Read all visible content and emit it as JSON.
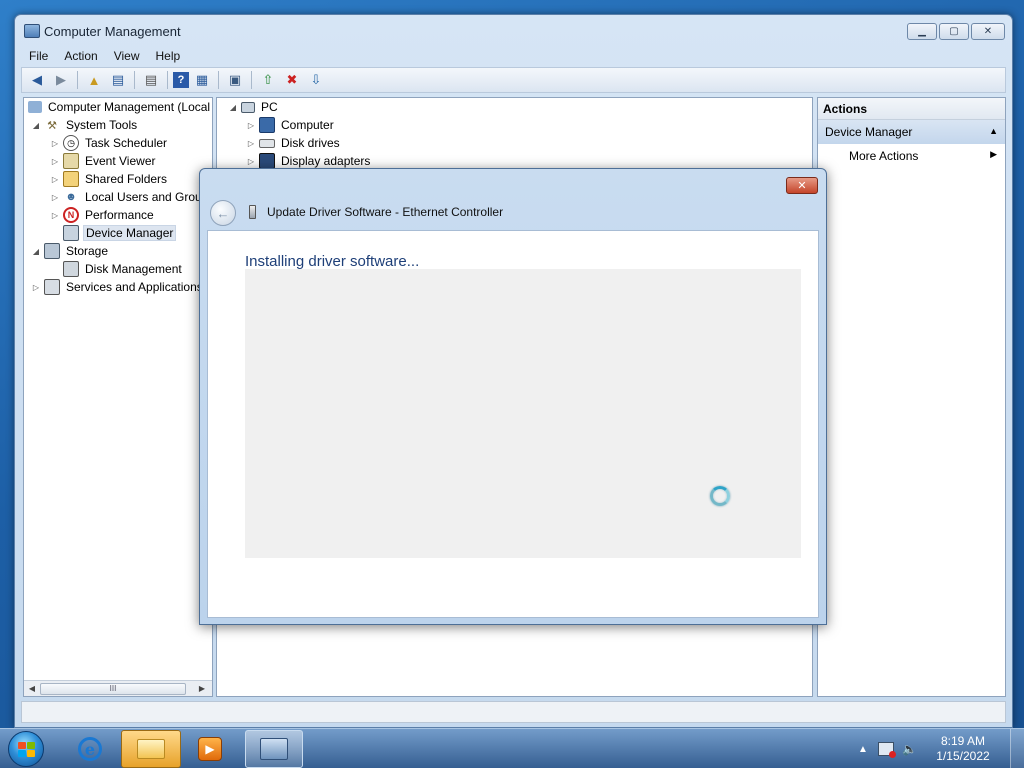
{
  "window": {
    "title": "Computer Management",
    "minimize_glyph": "▁",
    "maximize_glyph": "▢",
    "close_glyph": "✕"
  },
  "menu": [
    "File",
    "Action",
    "View",
    "Help"
  ],
  "toolbar": {
    "icons": [
      "back-arrow-icon",
      "forward-arrow-icon",
      "up-folder-icon",
      "show-hide-tree-icon",
      "properties-icon",
      "help-icon",
      "show-hide-action-pane-icon",
      "scan-hardware-icon",
      "update-driver-icon",
      "uninstall-icon",
      "enable-device-icon"
    ]
  },
  "tree": {
    "items": [
      {
        "label": "Computer Management (Local",
        "expander": "",
        "level": 0,
        "icon": "computer-management-icon"
      },
      {
        "label": "System Tools",
        "expander": "◢",
        "level": 1,
        "icon": "system-tools-icon"
      },
      {
        "label": "Task Scheduler",
        "expander": "▷",
        "level": 2,
        "icon": "task-scheduler-icon"
      },
      {
        "label": "Event Viewer",
        "expander": "▷",
        "level": 2,
        "icon": "event-viewer-icon"
      },
      {
        "label": "Shared Folders",
        "expander": "▷",
        "level": 2,
        "icon": "shared-folders-icon"
      },
      {
        "label": "Local Users and Group",
        "expander": "▷",
        "level": 2,
        "icon": "local-users-icon"
      },
      {
        "label": "Performance",
        "expander": "▷",
        "level": 2,
        "icon": "performance-icon"
      },
      {
        "label": "Device Manager",
        "expander": "",
        "level": 2,
        "icon": "device-manager-icon",
        "selected": true
      },
      {
        "label": "Storage",
        "expander": "◢",
        "level": 1,
        "icon": "storage-icon"
      },
      {
        "label": "Disk Management",
        "expander": "",
        "level": 2,
        "icon": "disk-management-icon"
      },
      {
        "label": "Services and Applications",
        "expander": "▷",
        "level": 1,
        "icon": "services-icon"
      }
    ],
    "scroll_thumb_label": "III"
  },
  "device_tree": {
    "root": {
      "label": "PC",
      "expander": "◢"
    },
    "items": [
      {
        "label": "Computer",
        "expander": "▷"
      },
      {
        "label": "Disk drives",
        "expander": "▷"
      },
      {
        "label": "Display adapters",
        "expander": "▷"
      }
    ]
  },
  "actions": {
    "header": "Actions",
    "section": "Device Manager",
    "items": [
      "More Actions"
    ]
  },
  "dialog": {
    "title": "Update Driver Software - Ethernet Controller",
    "heading": "Installing driver software...",
    "close_glyph": "✕",
    "back_glyph": "←"
  },
  "taskbar": {
    "time": "8:19 AM",
    "date": "1/15/2022",
    "ie_glyph": "e",
    "media_glyph": "▶",
    "tray_expand_glyph": "▲",
    "volume_glyph": "🔈"
  },
  "colors": {
    "accent_blue": "#1e3f78",
    "selection": "#dde5f0",
    "close_red": "#c4452a"
  }
}
